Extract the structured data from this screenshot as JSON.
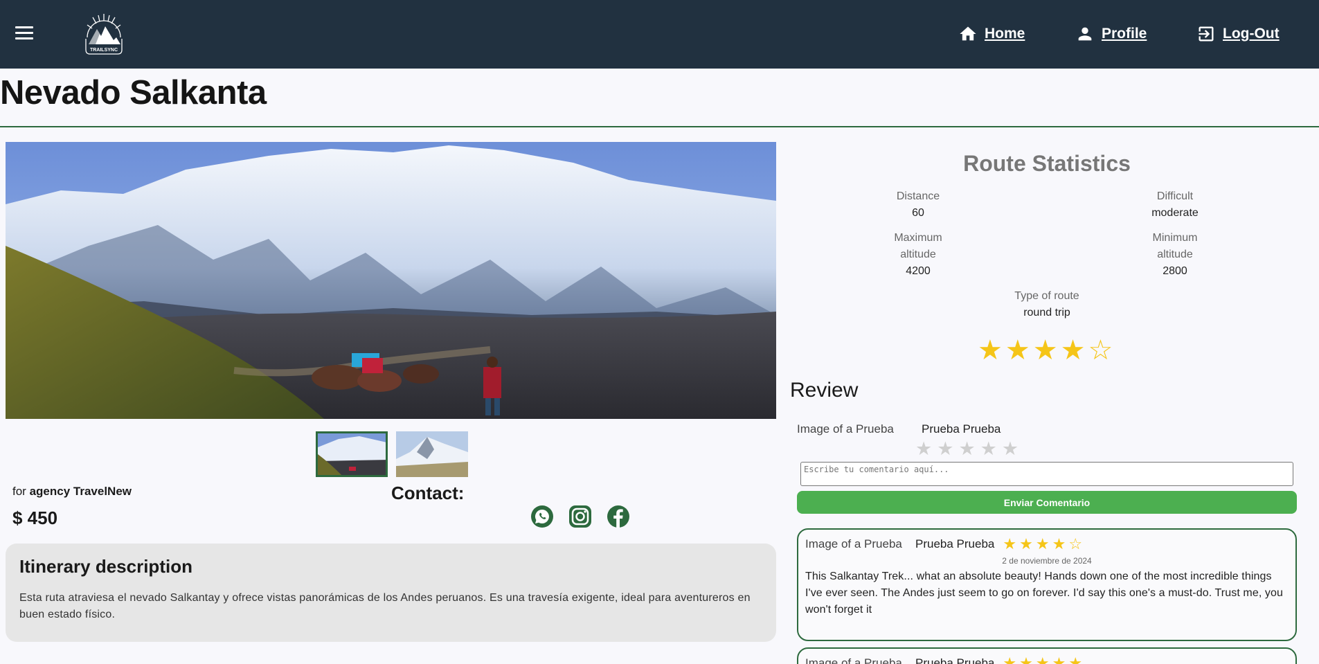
{
  "nav": {
    "logo_text": "TRAILSYNC",
    "links": [
      {
        "label": "Home",
        "icon": "home-icon"
      },
      {
        "label": "Profile",
        "icon": "person-icon"
      },
      {
        "label": "Log-Out",
        "icon": "logout-icon"
      }
    ]
  },
  "route": {
    "title": "Nevado Salkanta",
    "agency_prefix": "for",
    "agency_name": "agency TravelNew",
    "price": "$ 450",
    "contact_label": "Contact:",
    "social": [
      "whatsapp-icon",
      "instagram-icon",
      "facebook-icon"
    ]
  },
  "itinerary": {
    "title": "Itinerary description",
    "text": "Esta ruta atraviesa el nevado Salkantay y ofrece vistas panorámicas de los Andes peruanos. Es una travesía exigente, ideal para aventureros en buen estado físico."
  },
  "stats": {
    "title": "Route Statistics",
    "distance_label": "Distance",
    "distance_value": "60",
    "difficult_label": "Difficult",
    "difficult_value": "moderate",
    "max_alt_label_1": "Maximum",
    "max_alt_label_2": "altitude",
    "max_alt_value": "4200",
    "min_alt_label_1": "Minimum",
    "min_alt_label_2": "altitude",
    "min_alt_value": "2800",
    "type_label": "Type of route",
    "type_value": "round trip",
    "rating": 4,
    "rating_max": 5
  },
  "review": {
    "title": "Review",
    "form_image_alt": "Image of a Prueba",
    "form_user_name": "Prueba Prueba",
    "placeholder": "Escribe tu comentario aquí...",
    "send_label": "Enviar Comentario",
    "items": [
      {
        "image_alt": "Image of a Prueba",
        "name": "Prueba Prueba",
        "rating": 4,
        "date": "2 de noviembre de 2024",
        "text": "This Salkantay Trek... what an absolute beauty! Hands down one of the most incredible things I've ever seen. The Andes just seem to go on forever. I'd say this one's a must-do. Trust me, you won't forget it"
      },
      {
        "image_alt": "Image of a Prueba",
        "name": "Prueba Prueba",
        "rating": 5
      }
    ]
  },
  "colors": {
    "navbar": "#213140",
    "accent_green": "#2d6a3e",
    "button_green": "#4caf50",
    "star": "#f5c518"
  }
}
